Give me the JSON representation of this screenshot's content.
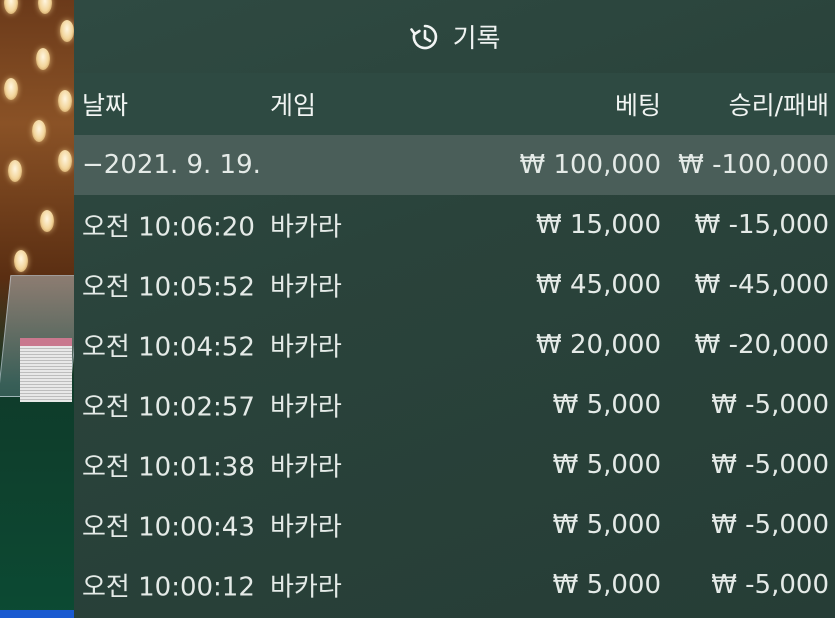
{
  "header": {
    "title": "기록",
    "icon": "history-icon"
  },
  "columns": {
    "date": "날짜",
    "game": "게임",
    "bet": "베팅",
    "result": "승리/패배"
  },
  "summary": {
    "date": "−2021. 9. 19.",
    "bet": "₩ 100,000",
    "result": "₩ -100,000"
  },
  "rows": [
    {
      "time": "오전 10:06:20",
      "game": "바카라",
      "bet": "₩ 15,000",
      "result": "₩ -15,000"
    },
    {
      "time": "오전 10:05:52",
      "game": "바카라",
      "bet": "₩ 45,000",
      "result": "₩ -45,000"
    },
    {
      "time": "오전 10:04:52",
      "game": "바카라",
      "bet": "₩ 20,000",
      "result": "₩ -20,000"
    },
    {
      "time": "오전 10:02:57",
      "game": "바카라",
      "bet": "₩ 5,000",
      "result": "₩ -5,000"
    },
    {
      "time": "오전 10:01:38",
      "game": "바카라",
      "bet": "₩ 5,000",
      "result": "₩ -5,000"
    },
    {
      "time": "오전 10:00:43",
      "game": "바카라",
      "bet": "₩ 5,000",
      "result": "₩ -5,000"
    },
    {
      "time": "오전 10:00:12",
      "game": "바카라",
      "bet": "₩ 5,000",
      "result": "₩ -5,000"
    }
  ]
}
